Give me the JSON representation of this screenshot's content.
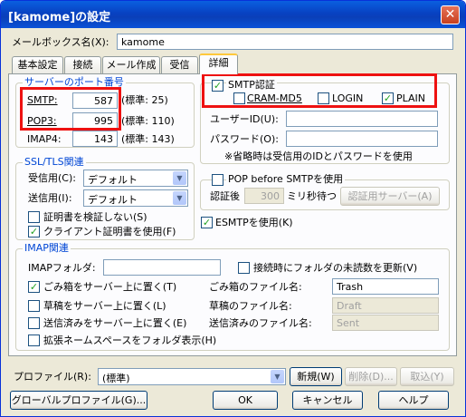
{
  "window": {
    "title": "[kamome]の設定",
    "close_symbol": "✕"
  },
  "mailbox": {
    "label": "メールボックス名(X):",
    "value": "kamome"
  },
  "tabs": [
    "基本設定",
    "接続",
    "メール作成",
    "受信",
    "詳細"
  ],
  "ports": {
    "group": "サーバーのポート番号",
    "rows": [
      {
        "label": "SMTP:",
        "value": "587",
        "std": "(標準: 25)"
      },
      {
        "label": "POP3:",
        "value": "995",
        "std": "(標準: 110)"
      },
      {
        "label": "IMAP4:",
        "value": "143",
        "std": "(標準: 143)"
      }
    ]
  },
  "ssl": {
    "group": "SSL/TLS関連",
    "recv_label": "受信用(C):",
    "recv_value": "デフォルト",
    "send_label": "送信用(I):",
    "send_value": "デフォルト",
    "verify": "証明書を検証しない(S)",
    "client_cert": "クライアント証明書を使用(F)"
  },
  "smtp_auth": {
    "label": "SMTP認証",
    "cram": "CRAM-MD5",
    "login": "LOGIN",
    "plain": "PLAIN",
    "userid": "ユーザーID(U):",
    "password": "パスワード(O):",
    "note": "※省略時は受信用のIDとパスワードを使用"
  },
  "pop_before": {
    "label": "POP before SMTPを使用",
    "wait_prefix": "認証後",
    "wait_value": "300",
    "wait_suffix": "ミリ秒待つ",
    "server_btn": "認証用サーバー(A)"
  },
  "esmtp": {
    "label": "ESMTPを使用(K)"
  },
  "imap": {
    "group": "IMAP関連",
    "folder_label": "IMAPフォルダ:",
    "folder_value": "",
    "unread": "接続時にフォルダの未読数を更新(V)",
    "trash": "ごみ箱をサーバー上に置く(T)",
    "trash_name_label": "ごみ箱のファイル名:",
    "trash_name": "Trash",
    "draft": "草稿をサーバー上に置く(L)",
    "draft_name_label": "草稿のファイル名:",
    "draft_name": "Draft",
    "sent": "送信済みをサーバー上に置く(E)",
    "sent_name_label": "送信済みのファイル名:",
    "sent_name": "Sent",
    "ns": "拡張ネームスペースをフォルダ表示(H)"
  },
  "profile": {
    "label": "プロファイル(R):",
    "value": "(標準)",
    "new_btn": "新規(W)",
    "del_btn": "削除(D)...",
    "cancel_btn": "取込(Y)"
  },
  "footer": {
    "global_btn": "グローバルプロファイル(G)...",
    "ok": "OK",
    "cancel": "キャンセル",
    "help": "ヘルプ"
  },
  "checks": {
    "check": "✓",
    "arrow": "▼"
  }
}
